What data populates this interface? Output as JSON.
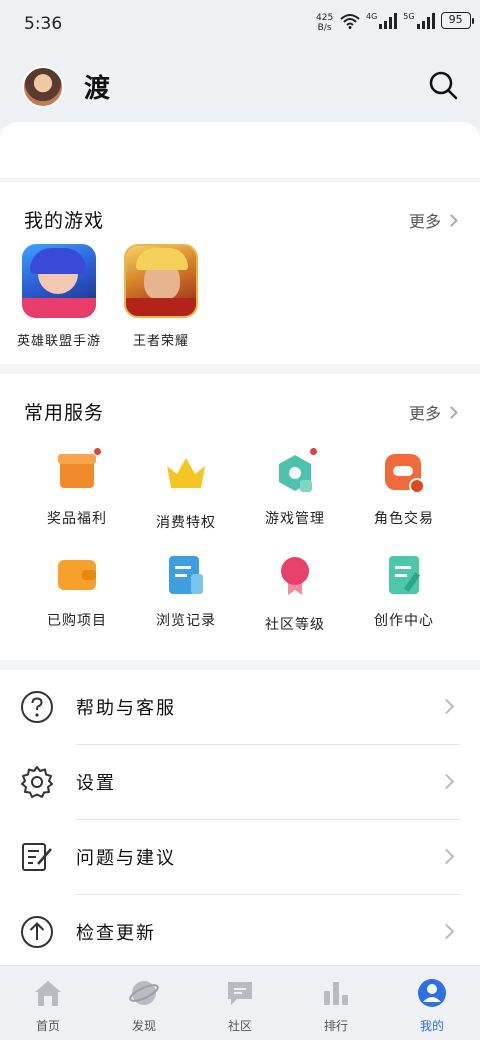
{
  "status": {
    "time": "5:36",
    "net_speed_value": "425",
    "net_speed_unit": "B/s",
    "sig1": "4G",
    "sig2": "5G",
    "battery": "95"
  },
  "header": {
    "username": "渡"
  },
  "my_games": {
    "title": "我的游戏",
    "more": "更多",
    "items": [
      {
        "name": "英雄联盟手游"
      },
      {
        "name": "王者荣耀"
      }
    ]
  },
  "services": {
    "title": "常用服务",
    "more": "更多",
    "items": [
      {
        "label": "奖品福利",
        "icon": "gift-icon",
        "color": "#f08a2a",
        "dot": true
      },
      {
        "label": "消费特权",
        "icon": "crown-icon",
        "color": "#f5c623",
        "dot": false
      },
      {
        "label": "游戏管理",
        "icon": "hexagon-icon",
        "color": "#4fc2ad",
        "dot": true
      },
      {
        "label": "角色交易",
        "icon": "trade-icon",
        "color": "#f26a3a",
        "dot": false
      },
      {
        "label": "已购项目",
        "icon": "wallet-icon",
        "color": "#f5a12c",
        "dot": false
      },
      {
        "label": "浏览记录",
        "icon": "history-icon",
        "color": "#3d9fe0",
        "dot": false
      },
      {
        "label": "社区等级",
        "icon": "medal-icon",
        "color": "#e8416a",
        "dot": false
      },
      {
        "label": "创作中心",
        "icon": "create-icon",
        "color": "#4cc8a8",
        "dot": false
      }
    ]
  },
  "menu": [
    {
      "label": "帮助与客服",
      "icon": "help-icon"
    },
    {
      "label": "设置",
      "icon": "settings-icon"
    },
    {
      "label": "问题与建议",
      "icon": "feedback-icon"
    },
    {
      "label": "检查更新",
      "icon": "update-icon"
    }
  ],
  "nav": [
    {
      "label": "首页",
      "icon": "home-icon"
    },
    {
      "label": "发现",
      "icon": "planet-icon"
    },
    {
      "label": "社区",
      "icon": "chat-icon"
    },
    {
      "label": "排行",
      "icon": "ranking-icon"
    },
    {
      "label": "我的",
      "icon": "profile-icon",
      "active": true
    }
  ],
  "colors": {
    "accent": "#2f6fe4",
    "reddot": "#e0433b"
  }
}
